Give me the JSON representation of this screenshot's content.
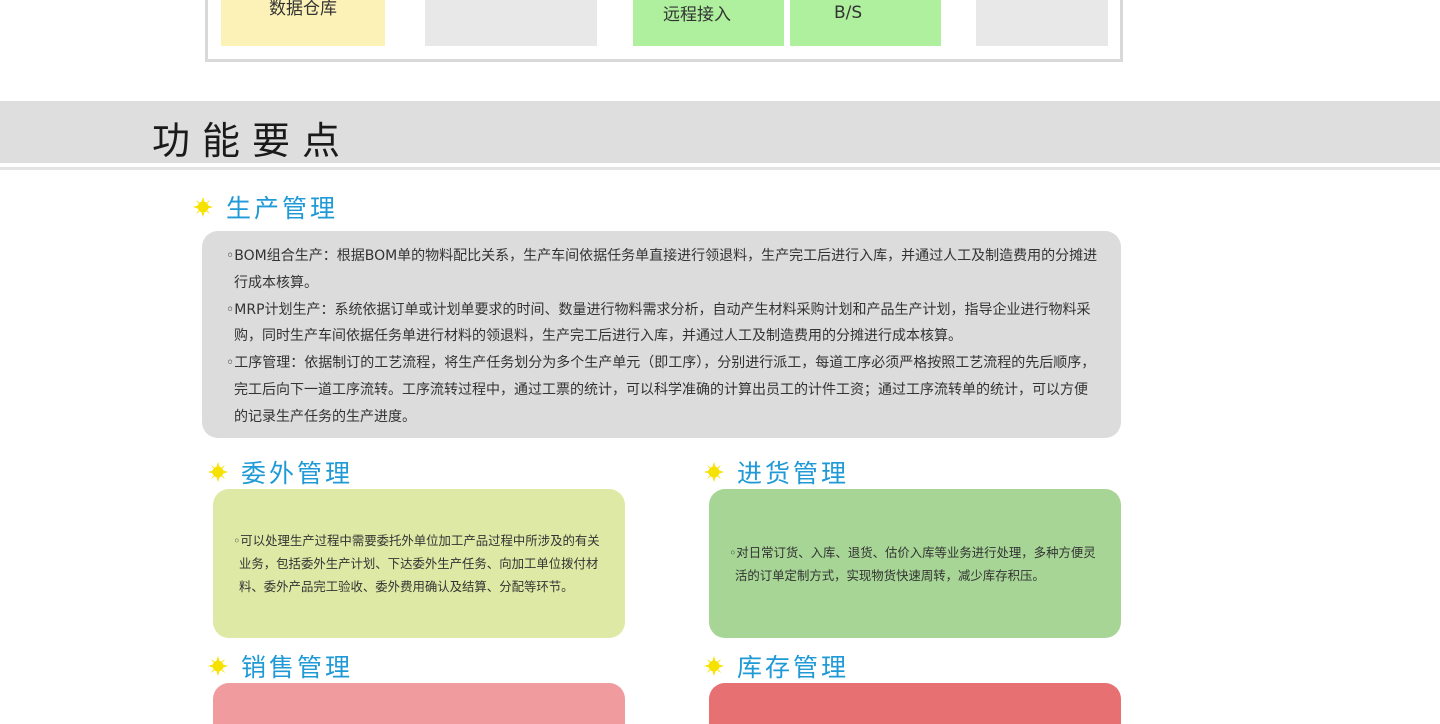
{
  "architecture": {
    "boxes": [
      {
        "id": "warehouse",
        "line1": "数据仓库"
      },
      {
        "id": "gray-1",
        "line1": ""
      },
      {
        "id": "remote",
        "line1": "",
        "line2": "远程接入"
      },
      {
        "id": "bs",
        "line1": "B/S"
      },
      {
        "id": "gray-2",
        "line1": ""
      }
    ]
  },
  "section": {
    "title": "功能要点"
  },
  "modules": [
    {
      "title": "生产管理",
      "items": [
        "◦BOM组合生产：根据BOM单的物料配比关系，生产车间依据任务单直接进行领退料，生产完工后进行入库，并通过人工及制造费用的分摊进行成本核算。",
        "◦MRP计划生产：系统依据订单或计划单要求的时间、数量进行物料需求分析，自动产生材料采购计划和产品生产计划，指导企业进行物料采购，同时生产车间依据任务单进行材料的领退料，生产完工后进行入库，并通过人工及制造费用的分摊进行成本核算。",
        "◦工序管理：依据制订的工艺流程，将生产任务划分为多个生产单元（即工序），分别进行派工，每道工序必须严格按照工艺流程的先后顺序，完工后向下一道工序流转。工序流转过程中，通过工票的统计，可以科学准确的计算出员工的计件工资；通过工序流转单的统计，可以方便的记录生产任务的生产进度。"
      ]
    },
    {
      "title": "委外管理",
      "items": [
        "◦可以处理生产过程中需要委托外单位加工产品过程中所涉及的有关业务，包括委外生产计划、下达委外生产任务、向加工单位拨付材料、委外产品完工验收、委外费用确认及结算、分配等环节。"
      ]
    },
    {
      "title": "进货管理",
      "items": [
        "◦对日常订货、入库、退货、估价入库等业务进行处理，多种方便灵活的订单定制方式，实现物货快速周转，减少库存积压。"
      ]
    },
    {
      "title": "销售管理",
      "items": []
    },
    {
      "title": "库存管理",
      "items": []
    }
  ],
  "colors": {
    "heading": "#1f9ad6",
    "star": "#f7e100",
    "panel_gray": "#dcdcdc",
    "panel_lime": "#dfe9a6",
    "panel_green": "#a6d595",
    "panel_pink": "#f09b9e",
    "panel_red": "#e67072"
  }
}
